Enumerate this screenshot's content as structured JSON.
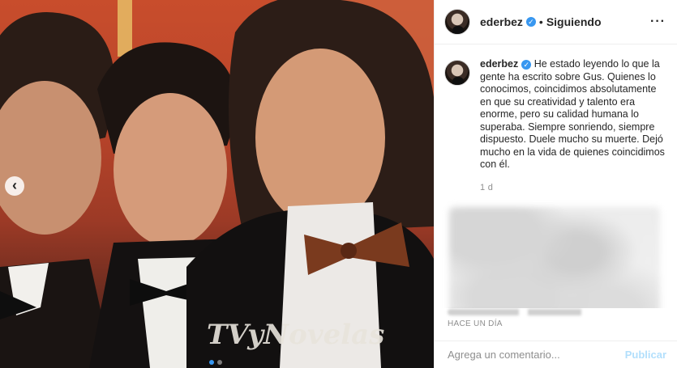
{
  "post": {
    "image_alt": "",
    "magazine_text": "TVyNovelas",
    "carousel": {
      "total": 2,
      "active": 1
    }
  },
  "header": {
    "username": "ederbez",
    "verified_icon": "verified-check-icon",
    "separator": "•",
    "follow_status": "Siguiendo",
    "more_icon": "more-options-icon"
  },
  "caption": {
    "username": "ederbez",
    "text": "He estado leyendo lo que la gente ha escrito sobre Gus. Quienes lo conocimos, coincidimos absolutamente en que su creatividad y talento era enorme, pero su calidad humana lo superaba. Siempre sonriendo, siempre dispuesto. Duele mucho su muerte. Dejó mucho en la vida de quienes coincidimos con él.",
    "time": "1 d"
  },
  "footer": {
    "posted": "HACE UN DÍA"
  },
  "comment_box": {
    "placeholder": "Agrega un comentario...",
    "post_label": "Publicar"
  },
  "colors": {
    "accent": "#3897f0",
    "post_disabled": "#b2dffc",
    "muted": "#8e8e8e"
  }
}
